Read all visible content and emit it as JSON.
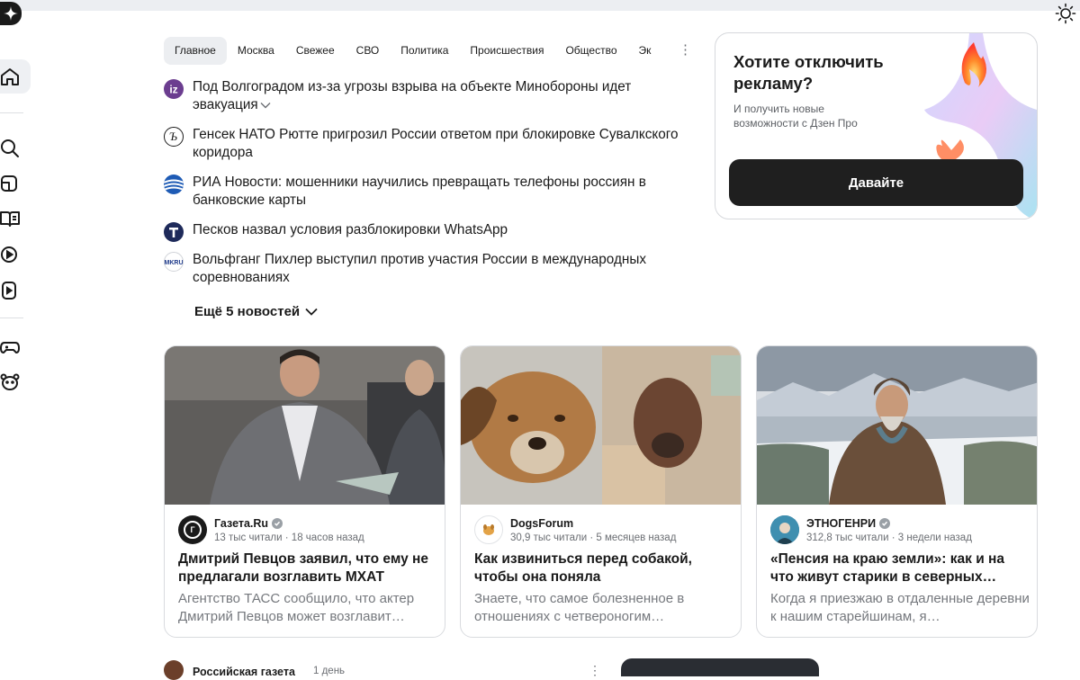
{
  "tabs": [
    "Главное",
    "Москва",
    "Свежее",
    "СВО",
    "Политика",
    "Происшествия",
    "Общество",
    "Эк"
  ],
  "news": [
    {
      "text": "Под Волгоградом из-за угрозы взрыва на объекте Минобороны идет эвакуация",
      "source_icon": "izvestia-icon",
      "has_chevron": true
    },
    {
      "text": "Генсек НАТО Рютте пригрозил России ответом при блокировке Сувалкского коридора",
      "source_icon": "kommersant-icon"
    },
    {
      "text": "РИА Новости: мошенники научились превращать телефоны россиян в банковские карты",
      "source_icon": "ria-icon"
    },
    {
      "text": "Песков назвал условия разблокировки WhatsApp",
      "source_icon": "t-icon"
    },
    {
      "text": "Вольфганг Пихлер выступил против участия России в международных соревнованиях",
      "source_icon": "mkru-icon"
    }
  ],
  "more_news": "Ещё 5 новостей",
  "promo": {
    "title": "Хотите отключить рекламу?",
    "subtitle": "И получить новые возможности с Дзен Про",
    "button": "Давайте"
  },
  "cards": [
    {
      "source": "Газета.Ru",
      "verified": true,
      "readers": "13 тыс читали",
      "time": "18 часов назад",
      "title": "Дмитрий Певцов заявил, что ему не предлагали возглавить МХАТ",
      "desc": "Агентство ТАСС сообщило, что актер Дмитрий Певцов может возглавит…"
    },
    {
      "source": "DogsForum",
      "verified": false,
      "readers": "30,9 тыс читали",
      "time": "5 месяцев назад",
      "title": "Как извиниться перед собакой, чтобы она поняла",
      "desc": "Знаете, что самое болезненное в отношениях с четвероногим…"
    },
    {
      "source": "ЭТНОГЕНРИ",
      "verified": true,
      "readers": "312,8 тыс читали",
      "time": "3 недели назад",
      "title": "«Пенсия на краю земли»: как и на что живут старики в северных…",
      "desc": "Когда я приезжаю в отдаленные деревни к нашим старейшинам, я…"
    }
  ],
  "bottom": {
    "source": "Российская газета",
    "time": "1 день"
  },
  "colors": {
    "accent_dark": "#1f1f1f",
    "verified": "#9aa0a6"
  }
}
